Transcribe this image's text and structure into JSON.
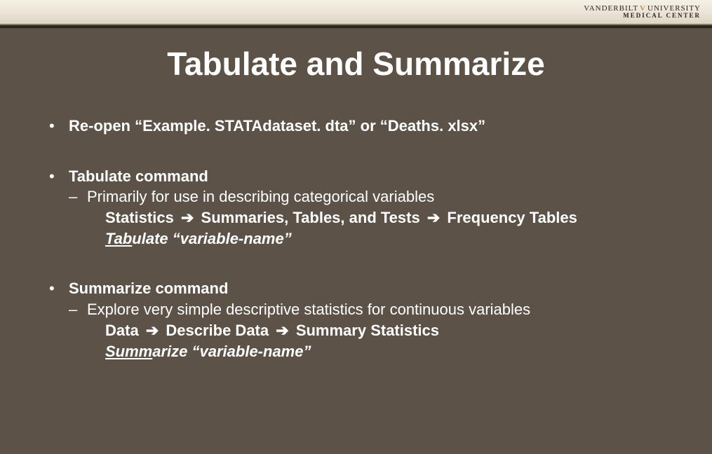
{
  "brand": {
    "line1_a": "VANDERBILT",
    "line1_b": "UNIVERSITY",
    "v": "V",
    "line2": "MEDICAL CENTER"
  },
  "title": "Tabulate and Summarize",
  "bullets": {
    "b1": "Re-open “Example. STATAdataset. dta” or “Deaths. xlsx”",
    "b2_head": "Tabulate command",
    "b2_sub": "Primarily for use in describing categorical variables",
    "b2_path_a": "Statistics",
    "b2_path_b": "Summaries, Tables, and Tests",
    "b2_path_c": "Frequency Tables",
    "b2_cmd_u": "Tab",
    "b2_cmd_rest": "ulate “variable-name”",
    "b3_head": "Summarize command",
    "b3_sub": "Explore very simple descriptive statistics for continuous variables",
    "b3_path_a": "Data",
    "b3_path_b": "Describe Data",
    "b3_path_c": "Summary Statistics",
    "b3_cmd_u": "Summ",
    "b3_cmd_rest": "arize “variable-name”"
  },
  "glyphs": {
    "bullet": "•",
    "dash": "–",
    "arrow": "➔"
  }
}
